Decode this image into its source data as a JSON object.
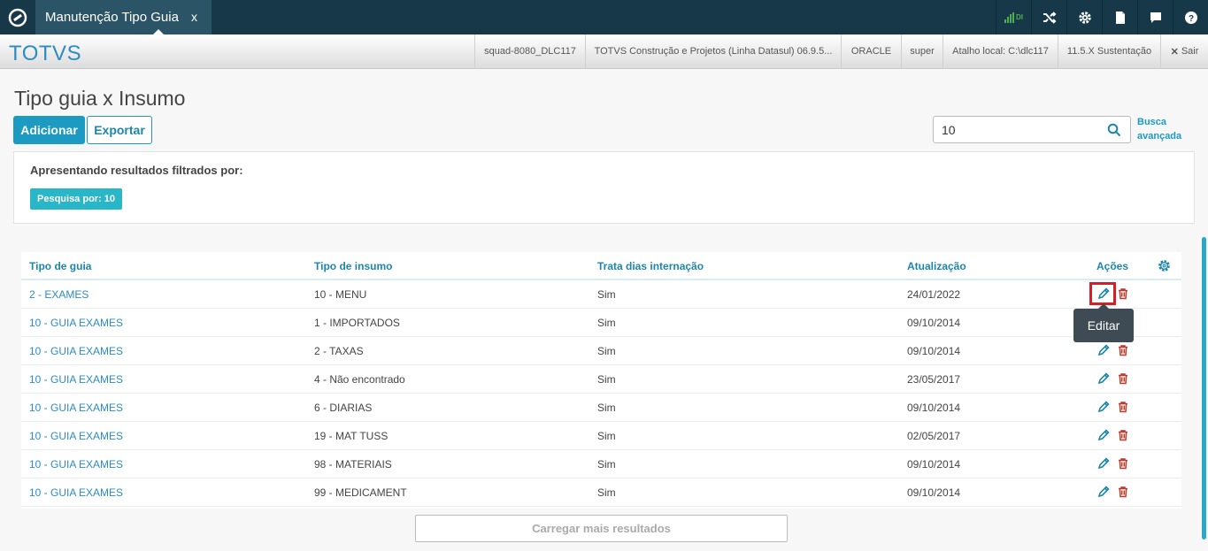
{
  "app": {
    "tab_title": "Manutenção Tipo Guia",
    "tab_close": "x",
    "signal_label": "DI",
    "brand": "TOTVS",
    "info": [
      "squad-8080_DLC117",
      "TOTVS Construção e Projetos (Linha Datasul) 06.9.5...",
      "ORACLE",
      "super",
      "Atalho local: C:\\dlc117",
      "11.5.X Sustentação"
    ],
    "logout": "Sair"
  },
  "page": {
    "title": "Tipo guia x Insumo",
    "add_label": "Adicionar",
    "export_label": "Exportar",
    "search_value": "10",
    "advanced_search": [
      "Busca",
      "avançada"
    ],
    "filter_title": "Apresentando resultados filtrados por:",
    "filter_chip": "Pesquisa por: 10",
    "load_more": "Carregar mais resultados",
    "tooltip": "Editar"
  },
  "table": {
    "headers": [
      "Tipo de guia",
      "Tipo de insumo",
      "Trata dias internação",
      "Atualização",
      "Ações"
    ],
    "rows": [
      [
        "2 - EXAMES",
        "10 - MENU",
        "Sim",
        "24/01/2022"
      ],
      [
        "10 - GUIA EXAMES",
        "1 - IMPORTADOS",
        "Sim",
        "09/10/2014"
      ],
      [
        "10 - GUIA EXAMES",
        "2 - TAXAS",
        "Sim",
        "09/10/2014"
      ],
      [
        "10 - GUIA EXAMES",
        "4 - Não encontrado",
        "Sim",
        "23/05/2017"
      ],
      [
        "10 - GUIA EXAMES",
        "6 - DIARIAS",
        "Sim",
        "09/10/2014"
      ],
      [
        "10 - GUIA EXAMES",
        "19 - MAT TUSS",
        "Sim",
        "02/05/2017"
      ],
      [
        "10 - GUIA EXAMES",
        "98 - MATERIAIS",
        "Sim",
        "09/10/2014"
      ],
      [
        "10 - GUIA EXAMES",
        "99 - MEDICAMENT",
        "Sim",
        "09/10/2014"
      ]
    ]
  },
  "colors": {
    "accent": "#1c9ac2",
    "topbar": "#163848",
    "delete": "#c0392b",
    "highlight": "#d32027"
  },
  "icons": [
    "totvs-logo-icon",
    "signal-icon",
    "shuffle-icon",
    "gear-icon",
    "document-icon",
    "chat-icon",
    "help-icon",
    "close-icon",
    "search-icon",
    "edit-icon",
    "trash-icon",
    "settings-icon"
  ]
}
